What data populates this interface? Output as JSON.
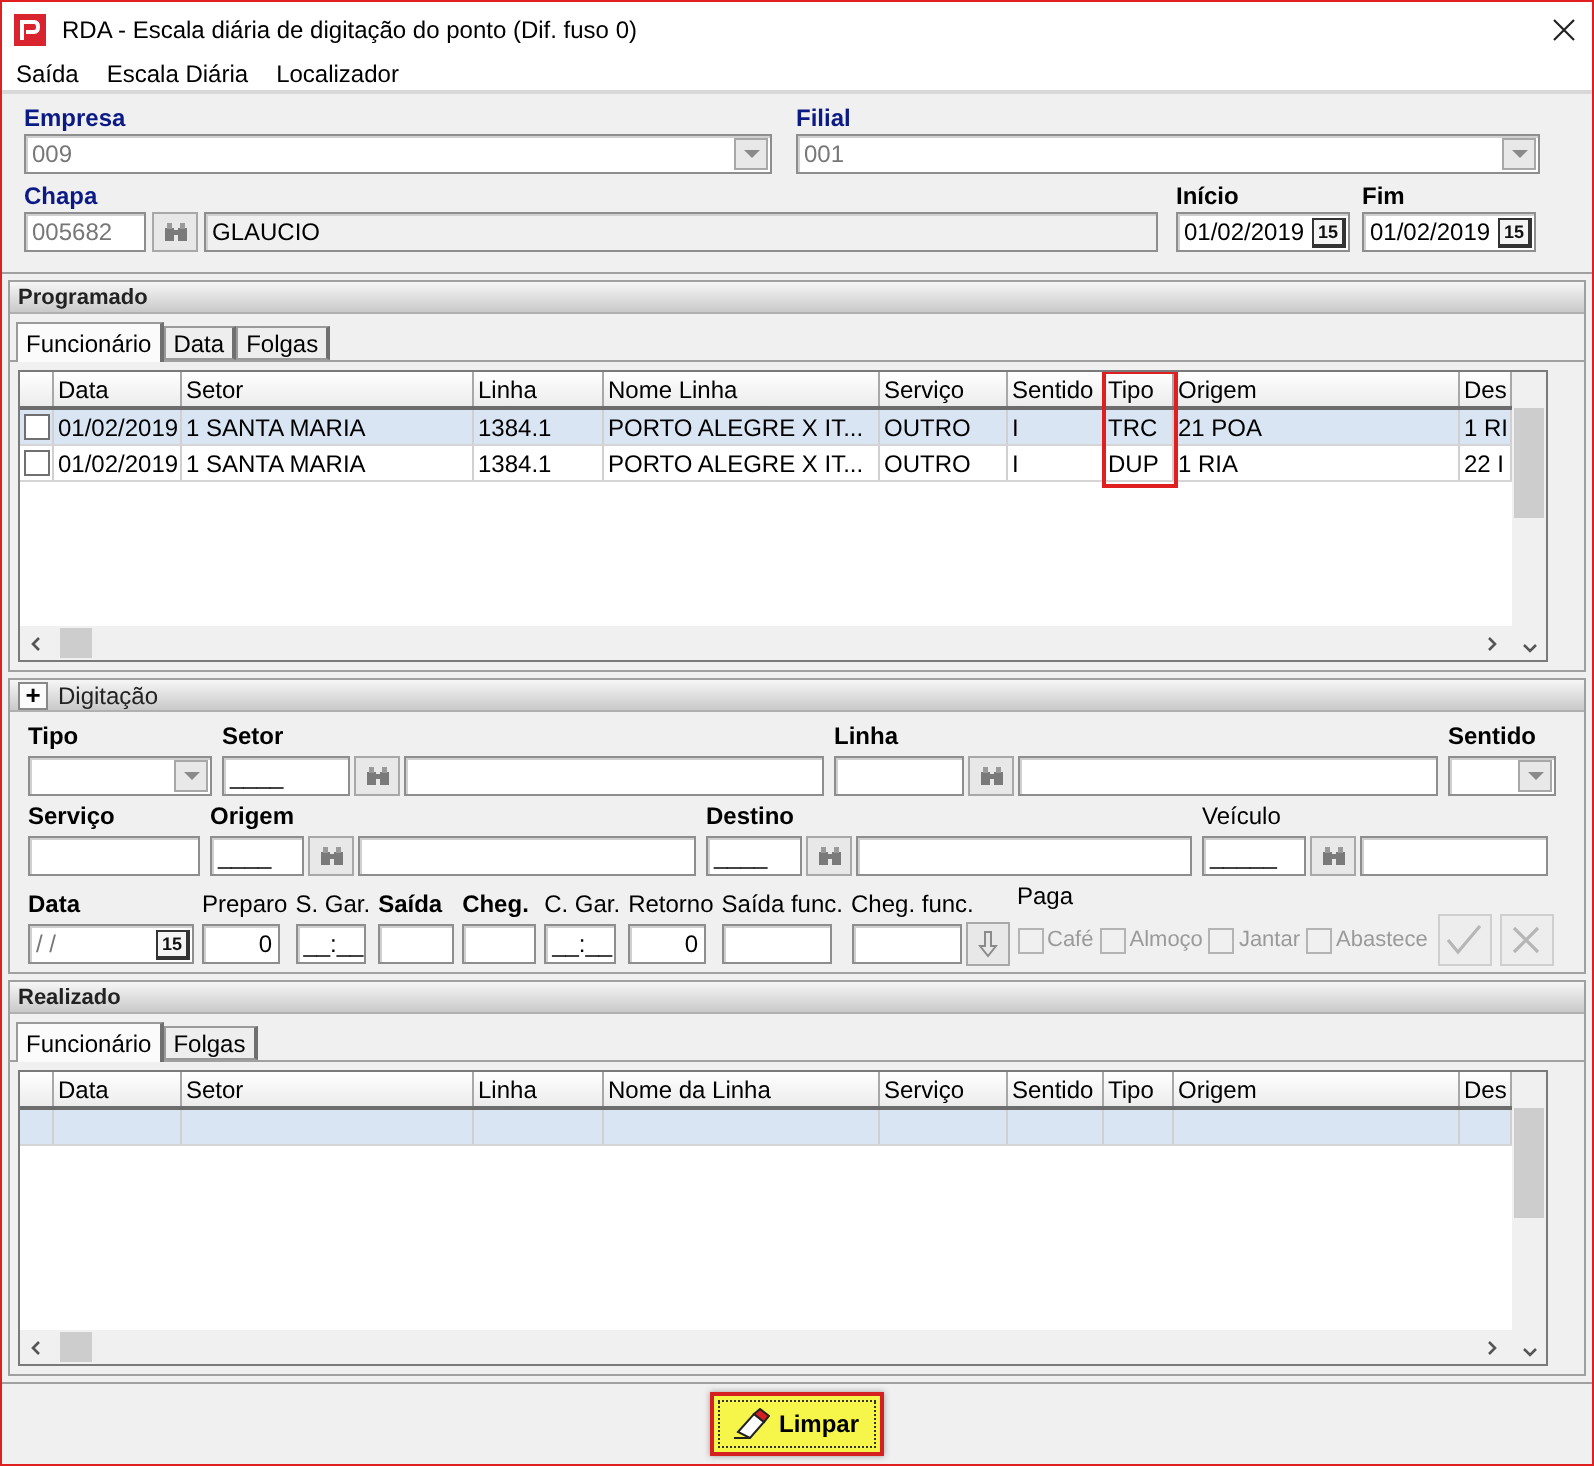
{
  "window": {
    "title": "RDA - Escala diária de digitação do ponto (Dif. fuso 0)"
  },
  "menu": [
    "Saída",
    "Escala Diária",
    "Localizador"
  ],
  "header": {
    "empresa": {
      "label": "Empresa",
      "value": "009",
      "disabled": true
    },
    "filial": {
      "label": "Filial",
      "value": "001",
      "disabled": true
    },
    "chapa": {
      "label": "Chapa",
      "value": "005682",
      "disabled": true,
      "name": "GLAUCIO"
    },
    "inicio": {
      "label": "Início",
      "value": "01/02/2019",
      "button": "15"
    },
    "fim": {
      "label": "Fim",
      "value": "01/02/2019",
      "button": "15"
    }
  },
  "programado": {
    "title": "Programado",
    "tabs": [
      {
        "label": "Funcionário",
        "selected": true
      },
      {
        "label": "Data",
        "selected": false
      },
      {
        "label": "Folgas",
        "selected": false
      }
    ],
    "grid": {
      "columns": [
        {
          "label": "Data",
          "highlighted": false
        },
        {
          "label": "Setor",
          "highlighted": false
        },
        {
          "label": "Linha",
          "highlighted": false
        },
        {
          "label": "Nome Linha",
          "highlighted": false
        },
        {
          "label": "Serviço",
          "highlighted": false
        },
        {
          "label": "Sentido",
          "highlighted": false
        },
        {
          "label": "Tipo",
          "highlighted": true
        },
        {
          "label": "Origem",
          "highlighted": false
        },
        {
          "label": "Des",
          "highlighted": false
        }
      ],
      "rows": [
        {
          "selected": true,
          "checked": false,
          "cells": [
            "01/02/2019",
            "1 SANTA MARIA",
            "1384.1",
            "PORTO ALEGRE X IT...",
            "OUTRO",
            "I",
            "TRC",
            "21 POA",
            "1 RI"
          ]
        },
        {
          "selected": false,
          "checked": false,
          "cells": [
            "01/02/2019",
            "1 SANTA MARIA",
            "1384.1",
            "PORTO ALEGRE X IT...",
            "OUTRO",
            "I",
            "DUP",
            "1 RIA",
            "22 I"
          ]
        }
      ]
    }
  },
  "digitacao": {
    "title": "Digitação",
    "toggle": "+",
    "lines": [
      {
        "fields": [
          {
            "label": "Tipo",
            "required": true,
            "controls": [
              {
                "kind": "combo"
              }
            ]
          },
          {
            "label": "Setor",
            "required": true,
            "controls": [
              {
                "kind": "text",
                "value": "____"
              },
              {
                "kind": "lookup"
              },
              {
                "kind": "text"
              }
            ]
          },
          {
            "label": "Linha",
            "required": true,
            "controls": [
              {
                "kind": "text"
              },
              {
                "kind": "lookup"
              },
              {
                "kind": "text"
              }
            ]
          },
          {
            "label": "Sentido",
            "required": true,
            "controls": [
              {
                "kind": "combo"
              }
            ]
          }
        ]
      },
      {
        "fields": [
          {
            "label": "Serviço",
            "required": true,
            "controls": [
              {
                "kind": "text"
              }
            ]
          },
          {
            "label": "Origem",
            "required": true,
            "controls": [
              {
                "kind": "text",
                "value": "____"
              },
              {
                "kind": "lookup"
              },
              {
                "kind": "text"
              }
            ]
          },
          {
            "label": "Destino",
            "required": true,
            "controls": [
              {
                "kind": "text",
                "value": "____"
              },
              {
                "kind": "lookup"
              },
              {
                "kind": "text"
              }
            ]
          },
          {
            "label": "Veículo",
            "required": false,
            "controls": [
              {
                "kind": "text",
                "value": "_____"
              },
              {
                "kind": "lookup"
              },
              {
                "kind": "text"
              }
            ]
          }
        ]
      },
      {
        "fields": [
          {
            "label": "Data",
            "required": true,
            "controls": [
              {
                "kind": "date",
                "value": "/ /",
                "disabled": true,
                "button": "15"
              }
            ]
          },
          {
            "label": "Preparo",
            "required": false,
            "controls": [
              {
                "kind": "number",
                "value": "0"
              }
            ]
          },
          {
            "label": "S. Gar.",
            "required": false,
            "controls": [
              {
                "kind": "text",
                "value": "__:__"
              }
            ]
          },
          {
            "label": "Saída",
            "required": true,
            "controls": [
              {
                "kind": "text"
              }
            ]
          },
          {
            "label": "Cheg.",
            "required": true,
            "controls": [
              {
                "kind": "text"
              }
            ]
          },
          {
            "label": "C. Gar.",
            "required": false,
            "controls": [
              {
                "kind": "text",
                "value": "__:__"
              }
            ]
          },
          {
            "label": "Retorno",
            "required": false,
            "controls": [
              {
                "kind": "number",
                "value": "0"
              }
            ]
          },
          {
            "label": "Saída func.",
            "required": false,
            "controls": [
              {
                "kind": "text"
              }
            ]
          },
          {
            "label": "Cheg. func.",
            "required": false,
            "controls": [
              {
                "kind": "text"
              },
              {
                "kind": "arrow"
              }
            ]
          },
          {
            "label": "Paga",
            "required": false,
            "controls": [
              {
                "kind": "check",
                "label": "Café",
                "checked": false,
                "disabled": true
              },
              {
                "kind": "check",
                "label": "Almoço",
                "checked": false,
                "disabled": true
              },
              {
                "kind": "check",
                "label": "Jantar",
                "checked": false,
                "disabled": true
              },
              {
                "kind": "check",
                "label": "Abastece",
                "checked": false,
                "disabled": true
              },
              {
                "kind": "confirm",
                "disabled": true
              },
              {
                "kind": "cancel",
                "disabled": true
              }
            ]
          }
        ]
      }
    ]
  },
  "realizado": {
    "title": "Realizado",
    "tabs": [
      {
        "label": "Funcionário",
        "selected": true
      },
      {
        "label": "Folgas",
        "selected": false
      }
    ],
    "grid": {
      "columns": [
        {
          "label": "Data",
          "highlighted": false
        },
        {
          "label": "Setor",
          "highlighted": false
        },
        {
          "label": "Linha",
          "highlighted": false
        },
        {
          "label": "Nome da Linha",
          "highlighted": false
        },
        {
          "label": "Serviço",
          "highlighted": false
        },
        {
          "label": "Sentido",
          "highlighted": false
        },
        {
          "label": "Tipo",
          "highlighted": false
        },
        {
          "label": "Origem",
          "highlighted": false
        },
        {
          "label": "Des",
          "highlighted": false
        }
      ],
      "rows": [
        {
          "selected": true
        }
      ]
    }
  },
  "limpar": {
    "label": "Limpar",
    "highlighted": true
  }
}
